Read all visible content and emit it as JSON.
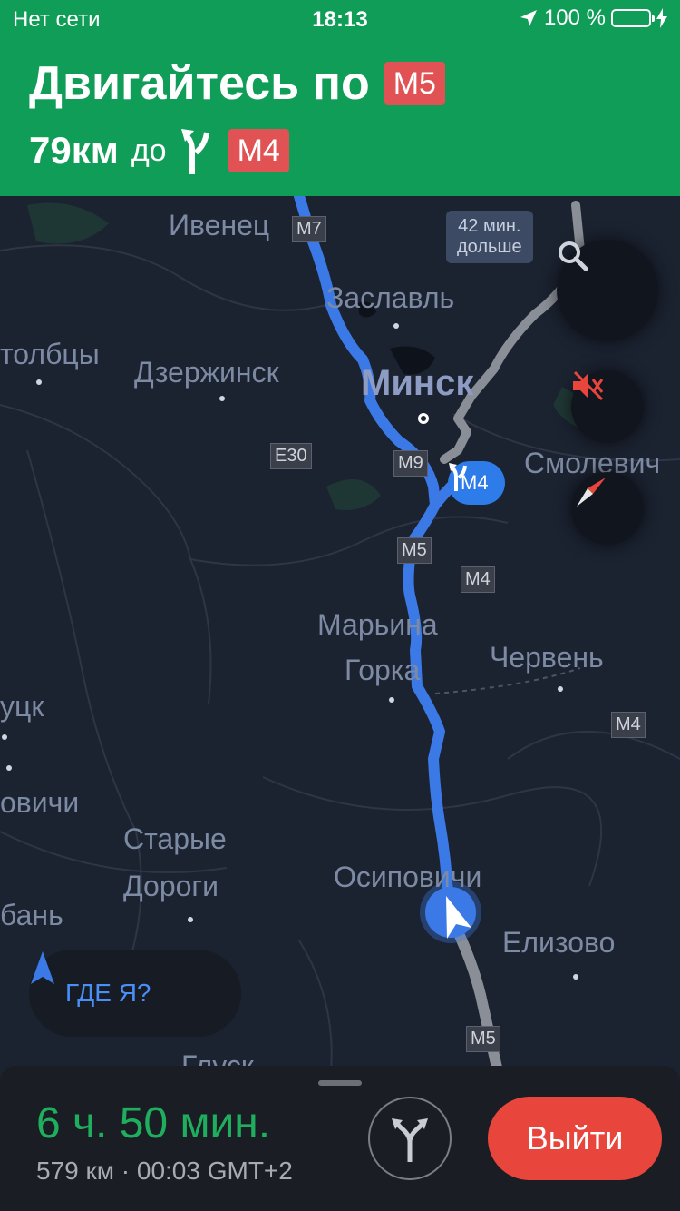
{
  "status_bar": {
    "carrier": "Нет сети",
    "time": "18:13",
    "battery_text": "100 %"
  },
  "nav_header": {
    "instruction": "Двигайтесь по",
    "road_current": "M5",
    "distance": "79км",
    "to_label": "до",
    "road_next": "M4"
  },
  "map": {
    "places": {
      "ivenec": "Ивенец",
      "zaslavl": "Заславль",
      "stolbcy": "толбцы",
      "dzerzhinsk": "Дзержинск",
      "minsk": "Минск",
      "smolevichi": "Смолевич",
      "marina_gorka_1": "Марьина",
      "marina_gorka_2": "Горка",
      "cherven": "Червень",
      "slutsk": "уцк",
      "ovichi": "овичи",
      "starye_dorogi_1": "Старые",
      "starye_dorogi_2": "Дороги",
      "osipovichi": "Осиповичи",
      "elizovo": "Елизово",
      "ban": "бань",
      "gluck": "Глуск"
    },
    "road_badges": {
      "m7": "M7",
      "e30": "E30",
      "m9": "M9",
      "m5_a": "M5",
      "m4_a": "M4",
      "m4_b": "M4",
      "m5_b": "M5"
    },
    "alt_route_callout": {
      "line1": "42 мин.",
      "line2": "дольше"
    },
    "turn_pill_road": "M4",
    "where_button": "ГДЕ Я?"
  },
  "bottom_panel": {
    "eta_duration": "6 ч. 50 мин.",
    "eta_details": "579 км · 00:03 GMT+2",
    "exit_button": "Выйти"
  },
  "colors": {
    "header_green": "#0f9d58",
    "route_blue": "#3b7ae6",
    "road_badge_red": "#e05254",
    "eta_green": "#1fae5e",
    "exit_red": "#e8453c"
  }
}
